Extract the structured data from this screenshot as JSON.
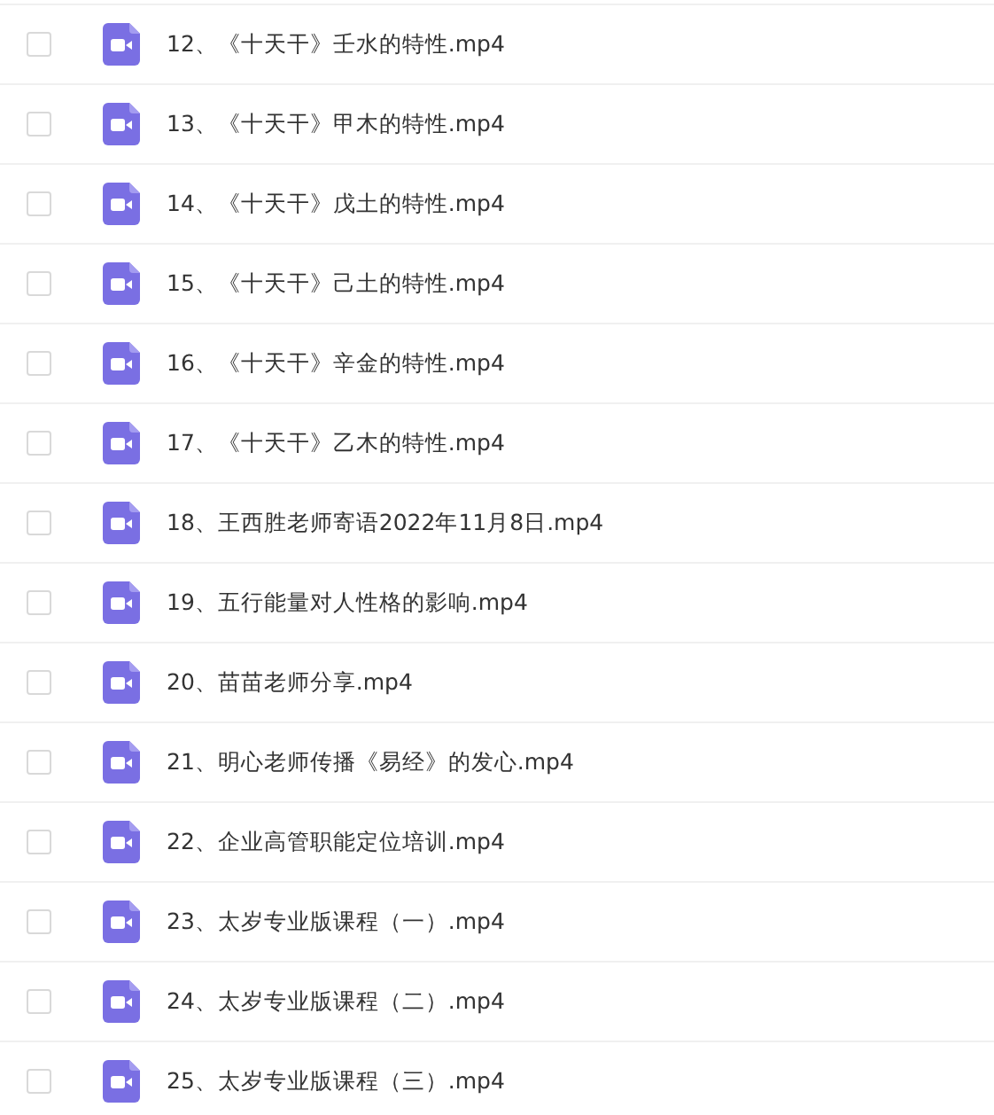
{
  "files": [
    {
      "name": "12、《十天干》壬水的特性.mp4",
      "checked": false
    },
    {
      "name": "13、《十天干》甲木的特性.mp4",
      "checked": false
    },
    {
      "name": "14、《十天干》戊土的特性.mp4",
      "checked": false
    },
    {
      "name": "15、《十天干》己土的特性.mp4",
      "checked": false
    },
    {
      "name": "16、《十天干》辛金的特性.mp4",
      "checked": false
    },
    {
      "name": "17、《十天干》乙木的特性.mp4",
      "checked": false
    },
    {
      "name": "18、王西胜老师寄语2022年11月8日.mp4",
      "checked": false
    },
    {
      "name": "19、五行能量对人性格的影响.mp4",
      "checked": false
    },
    {
      "name": "20、苗苗老师分享.mp4",
      "checked": false
    },
    {
      "name": "21、明心老师传播《易经》的发心.mp4",
      "checked": false
    },
    {
      "name": "22、企业高管职能定位培训.mp4",
      "checked": false
    },
    {
      "name": "23、太岁专业版课程（一）.mp4",
      "checked": false
    },
    {
      "name": "24、太岁专业版课程（二）.mp4",
      "checked": false
    },
    {
      "name": "25、太岁专业版课程（三）.mp4",
      "checked": false
    }
  ]
}
